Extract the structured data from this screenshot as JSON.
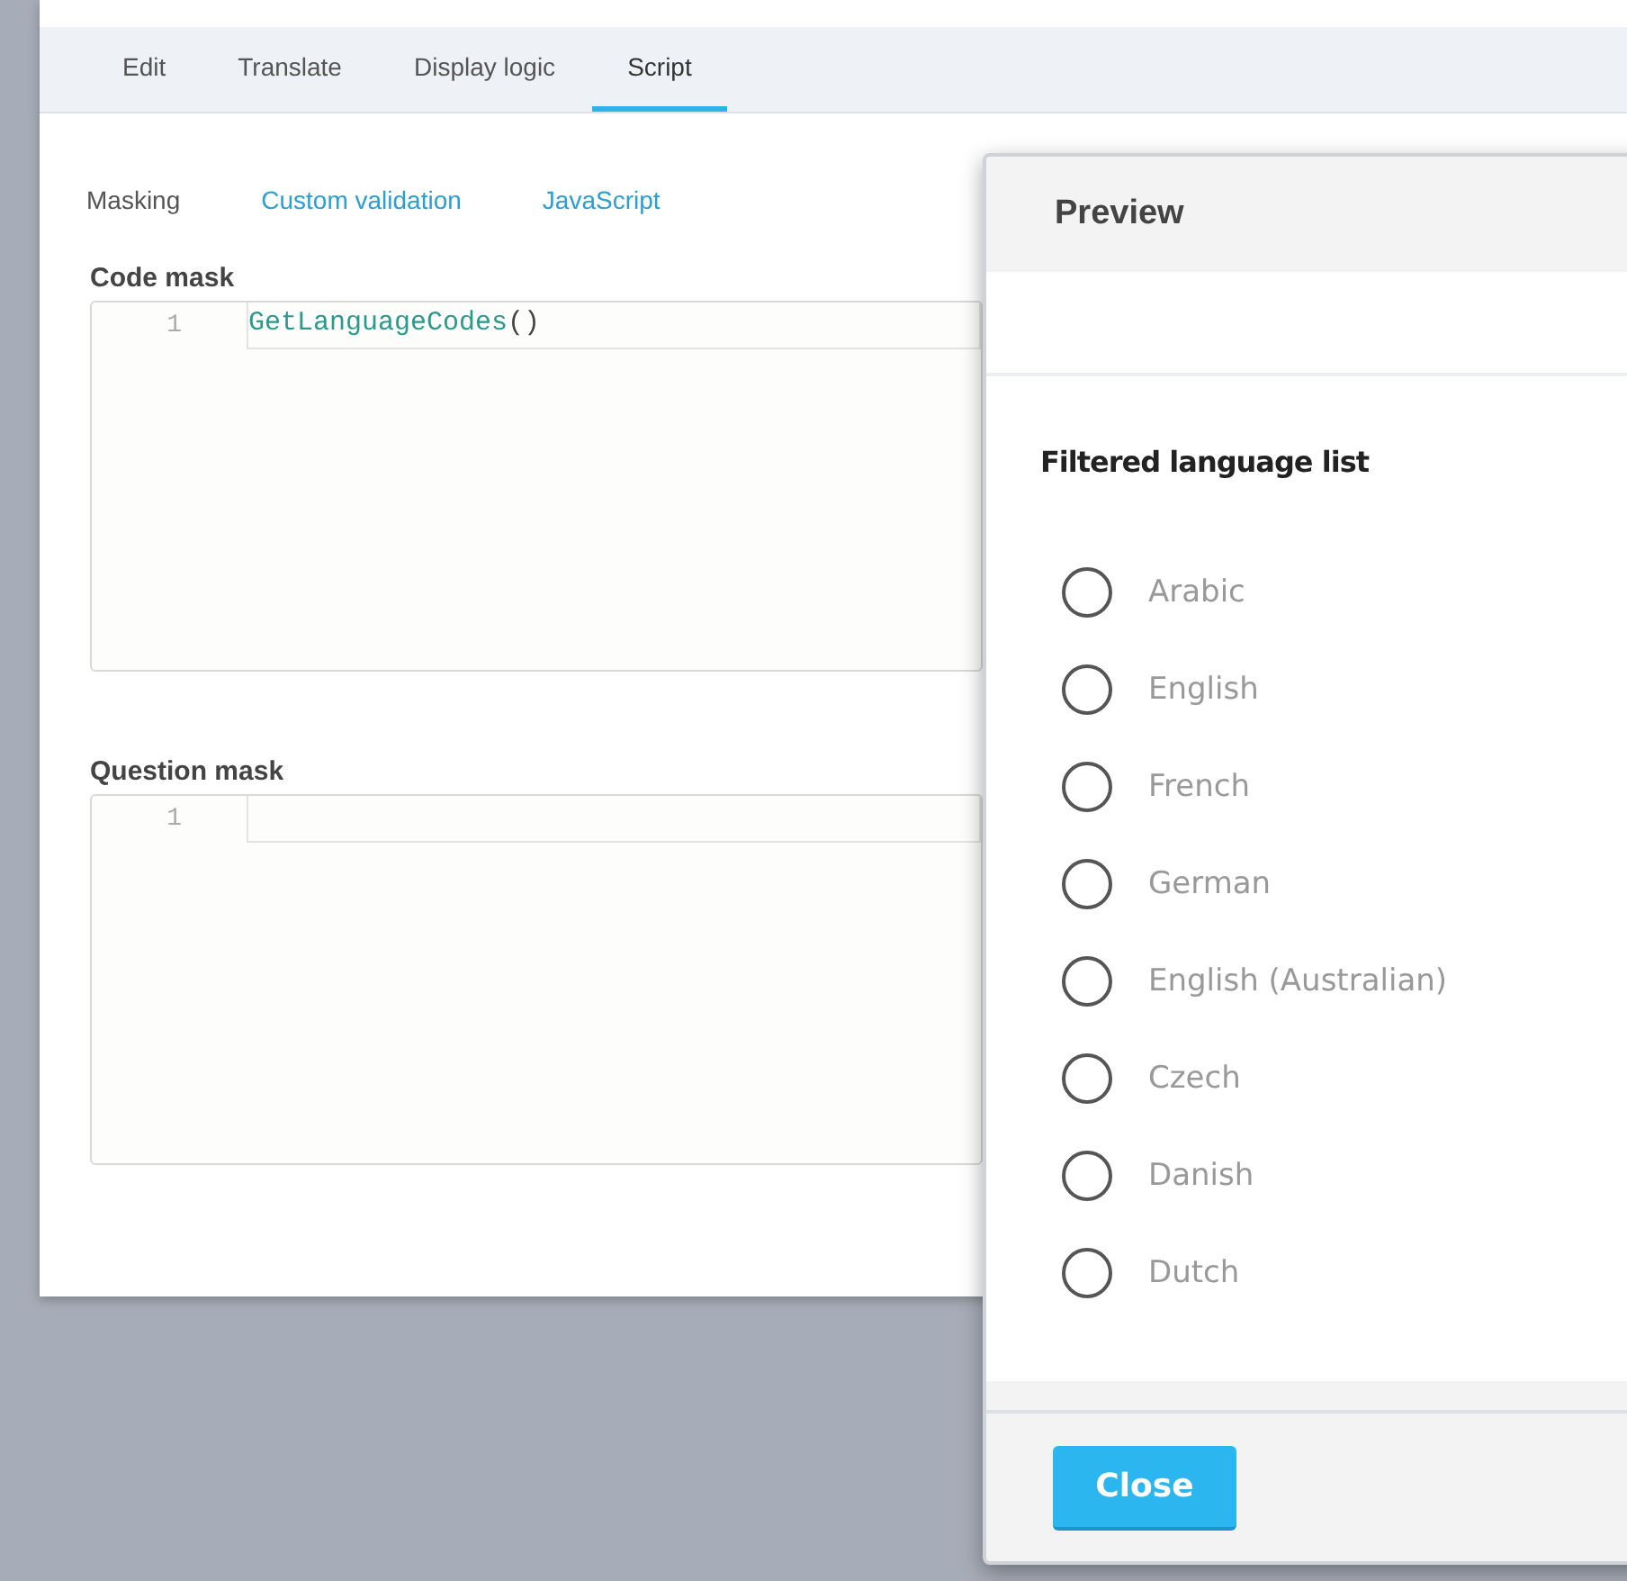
{
  "tabs": [
    {
      "label": "Edit",
      "selected": false
    },
    {
      "label": "Translate",
      "selected": false
    },
    {
      "label": "Display logic",
      "selected": false
    },
    {
      "label": "Script",
      "selected": true
    }
  ],
  "subtabs": [
    {
      "label": "Masking",
      "selected": true
    },
    {
      "label": "Custom validation",
      "selected": false
    },
    {
      "label": "JavaScript",
      "selected": false
    }
  ],
  "editors": [
    {
      "label": "Code mask",
      "lines": [
        {
          "number": "1",
          "function": "GetLanguageCodes",
          "punctuation": "()"
        }
      ]
    },
    {
      "label": "Question mask",
      "lines": [
        {
          "number": "1"
        }
      ]
    }
  ],
  "preview": {
    "title": "Preview",
    "question": "Filtered language list",
    "options": [
      {
        "label": "Arabic",
        "selected": false
      },
      {
        "label": "English",
        "selected": false
      },
      {
        "label": "French",
        "selected": false
      },
      {
        "label": "German",
        "selected": false
      },
      {
        "label": "English (Australian)",
        "selected": false
      },
      {
        "label": "Czech",
        "selected": false
      },
      {
        "label": "Danish",
        "selected": false
      },
      {
        "label": "Dutch",
        "selected": false
      }
    ],
    "close_button": "Close"
  }
}
